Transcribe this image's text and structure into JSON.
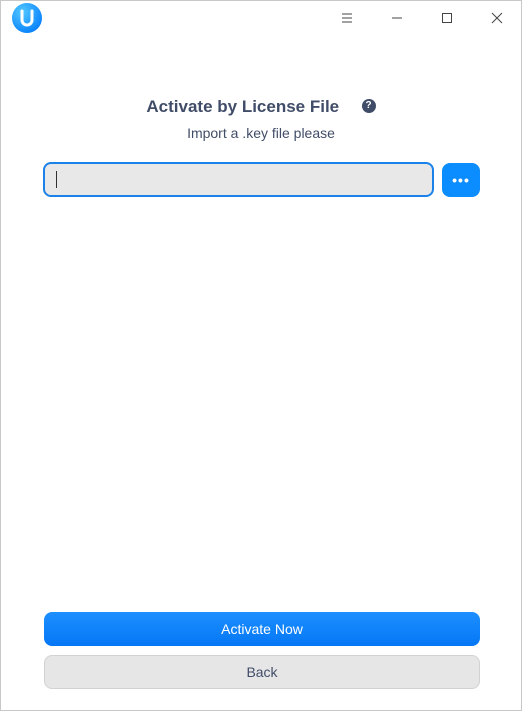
{
  "titlebar": {
    "logo_icon": "deepin-uos-logo-icon",
    "buttons": [
      {
        "name": "menu-icon",
        "glyph": "menu"
      },
      {
        "name": "minimize-icon",
        "glyph": "minimize"
      },
      {
        "name": "maximize-icon",
        "glyph": "maximize"
      },
      {
        "name": "close-icon",
        "glyph": "close"
      }
    ]
  },
  "main": {
    "title": "Activate by License File",
    "help_icon": "question-icon",
    "help_glyph": "?",
    "subtitle": "Import a .key file please",
    "file_input": {
      "value": "",
      "placeholder": ""
    },
    "browse_label": "•••"
  },
  "footer": {
    "primary_label": "Activate Now",
    "secondary_label": "Back"
  },
  "colors": {
    "accent": "#0b8cff",
    "title_text": "#414d68",
    "input_bg": "#e8e8e8",
    "secondary_bg": "#e6e6e6"
  }
}
